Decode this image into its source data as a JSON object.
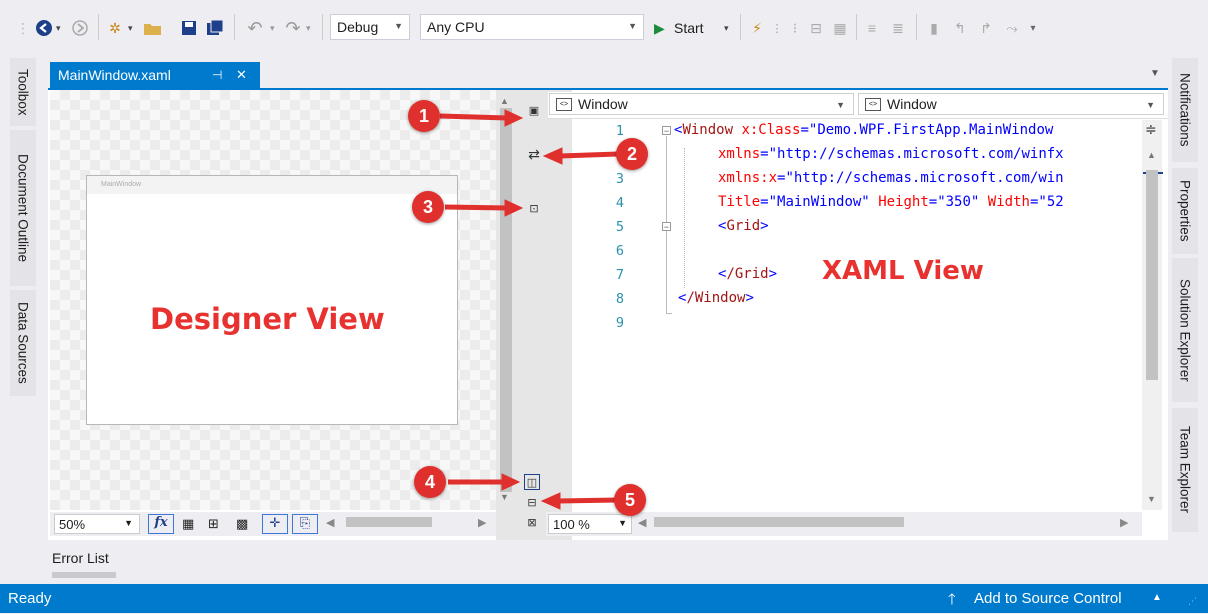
{
  "toolbar": {
    "config": "Debug",
    "platform": "Any CPU",
    "start_label": "Start"
  },
  "left_tabs": [
    "Toolbox",
    "Document Outline",
    "Data Sources"
  ],
  "right_tabs": [
    "Notifications",
    "Properties",
    "Solution Explorer",
    "Team Explorer"
  ],
  "doc_tab": {
    "title": "MainWindow.xaml",
    "pin": "⊣",
    "close": "✕"
  },
  "designer": {
    "window_title": "MainWindow",
    "label": "Designer View",
    "zoom": "50%",
    "fx": "fx"
  },
  "xaml": {
    "left_combo": "Window",
    "right_combo": "Window",
    "label": "XAML View",
    "zoom": "100 %",
    "line_numbers": [
      "1",
      "2",
      "3",
      "4",
      "5",
      "6",
      "7",
      "8",
      "9"
    ],
    "code": {
      "l1_tag": "Window",
      "l1_attr": "x:Class",
      "l1_val": "\"Demo.WPF.FirstApp.MainWindow",
      "l2_attr": "xmlns",
      "l2_val": "\"http://schemas.microsoft.com/winfx",
      "l3_attr": "xmlns:x",
      "l3_val": "\"http://schemas.microsoft.com/win",
      "l4_a1": "Title",
      "l4_v1": "\"MainWindow\"",
      "l4_a2": "Height",
      "l4_v2": "\"350\"",
      "l4_a3": "Width",
      "l4_v3": "\"52",
      "l5_tag": "Grid",
      "l7_tag": "/Grid",
      "l8_tag": "/Window"
    }
  },
  "callouts": [
    "1",
    "2",
    "3",
    "4",
    "5"
  ],
  "bottom_panel": {
    "tab": "Error List"
  },
  "status": {
    "left": "Ready",
    "right": "Add to Source Control"
  },
  "colors": {
    "accent": "#007acc",
    "callout": "#e0302d"
  }
}
